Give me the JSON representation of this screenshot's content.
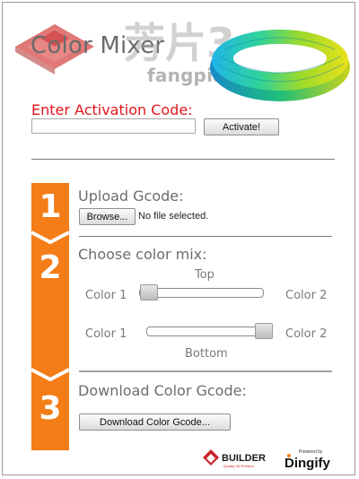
{
  "header": {
    "app_title": "Color Mixer",
    "watermark_text": "fangpian3.com",
    "watermark_chinese": "芳片3"
  },
  "activation": {
    "label": "Enter Activation Code:",
    "input_value": "",
    "button_label": "Activate!"
  },
  "steps": [
    {
      "number": "1",
      "title": "Upload Gcode:"
    },
    {
      "number": "2",
      "title": "Choose color mix:"
    },
    {
      "number": "3",
      "title": "Download Color Gcode:"
    }
  ],
  "upload": {
    "browse_label": "Browse...",
    "file_status": "No file selected."
  },
  "mix": {
    "top_label": "Top",
    "bottom_label": "Bottom",
    "top_slider": {
      "left_label": "Color 1",
      "right_label": "Color 2",
      "value": 0.0
    },
    "bottom_slider": {
      "left_label": "Color 1",
      "right_label": "Color 2",
      "value": 1.0
    }
  },
  "download": {
    "button_label": "Download Color Gcode..."
  },
  "footer": {
    "builder_logo": "BUILDER",
    "builder_tagline": "Quality 3D Printers",
    "dingify_powered": "Powered by",
    "dingify_logo": "Dingify"
  },
  "colors": {
    "accent_orange": "#f47d17",
    "label_red": "#e0161c",
    "logo_red": "#c8242a"
  }
}
